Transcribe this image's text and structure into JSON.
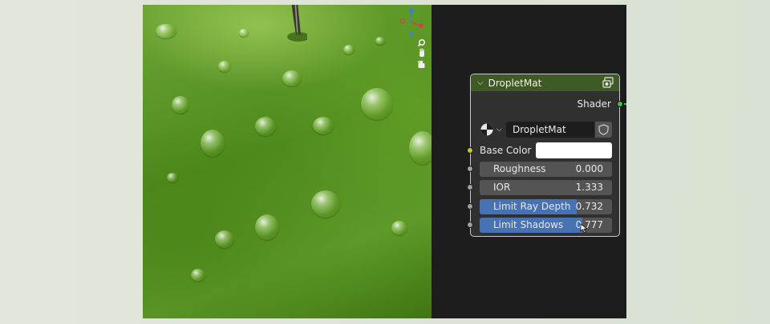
{
  "node": {
    "title": "DropletMat",
    "output_label": "Shader",
    "material_name": "DropletMat",
    "base_color_label": "Base Color",
    "base_color_value": "#ffffff",
    "header_color": "#3f5a25",
    "fields": [
      {
        "label": "Roughness",
        "value": "0.000",
        "fill": 0.0
      },
      {
        "label": "IOR",
        "value": "1.333",
        "fill": 0.0
      },
      {
        "label": "Limit Ray Depth",
        "value": "0.732",
        "fill": 0.732
      },
      {
        "label": "Limit Shadows",
        "value": "0.777",
        "fill": 0.777
      }
    ]
  },
  "icons": {
    "collapse": "chevron-down-icon",
    "preview": "node-preview-icon",
    "material_browse": "material-sphere-icon",
    "fake_user": "shield-icon",
    "zoom": "zoom-icon",
    "pan": "hand-icon",
    "camera": "camera-icon"
  },
  "colors": {
    "accent": "#4772b3",
    "socket_shader": "#3fbf50",
    "socket_color": "#c7c729",
    "socket_float": "#a1a1a1"
  }
}
